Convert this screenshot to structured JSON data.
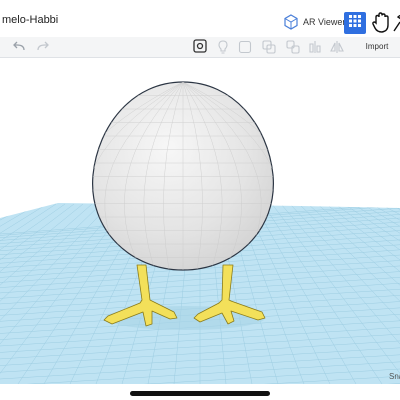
{
  "app": {
    "design_title": "melo-Habbi",
    "ar_viewer_label": "AR Viewer",
    "import_label": "Import",
    "snap_label": "Sna"
  },
  "icons": {
    "grid_view": "grid-icon",
    "hand": "hand-icon",
    "tools": "tools-icon",
    "undo": "undo-icon",
    "redo": "redo-icon"
  },
  "colors": {
    "accent": "#2f6fe0",
    "workplane": "#bfe3f3",
    "egg_body": "#e6e6e6",
    "chicken_feet": "#f3e05a"
  }
}
